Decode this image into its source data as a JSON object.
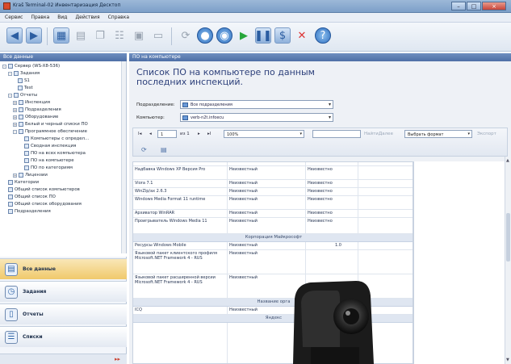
{
  "window": {
    "title": "Kraš Terminal-02 Инвентаризация Десктоп",
    "min": "–",
    "max": "□",
    "close": "×"
  },
  "menu": [
    "Сервис",
    "Правка",
    "Вид",
    "Действия",
    "Справка"
  ],
  "toolbar": {
    "icons": [
      "back-icon",
      "forward-icon",
      "grid-icon",
      "print-icon",
      "copy-icon",
      "tree-icon",
      "calendar-icon",
      "chat-icon",
      "refresh-icon",
      "stop-icon",
      "play-icon",
      "pause-icon",
      "link-icon",
      "delete-icon",
      "help-icon"
    ]
  },
  "left_panel": {
    "header": "Все данные",
    "tree": [
      {
        "label": "Сервер (WS-X8-536)",
        "level": 0,
        "toggle": "–"
      },
      {
        "label": "Задания",
        "level": 1,
        "toggle": "–"
      },
      {
        "label": "S1",
        "level": 2,
        "toggle": ""
      },
      {
        "label": "Test",
        "level": 2,
        "toggle": ""
      },
      {
        "label": "Отчеты",
        "level": 1,
        "toggle": "–"
      },
      {
        "label": "Инспекция",
        "level": 2,
        "toggle": "+"
      },
      {
        "label": "Подразделения",
        "level": 2,
        "toggle": "+"
      },
      {
        "label": "Оборудование",
        "level": 2,
        "toggle": "+"
      },
      {
        "label": "Белый и черный списки ПО",
        "level": 2,
        "toggle": "+"
      },
      {
        "label": "Программное обеспечение",
        "level": 2,
        "toggle": "–"
      },
      {
        "label": "Компьютеры с определ...",
        "level": 3,
        "toggle": ""
      },
      {
        "label": "Сводная инспекция",
        "level": 3,
        "toggle": ""
      },
      {
        "label": "ПО на всех компьютера",
        "level": 3,
        "toggle": ""
      },
      {
        "label": "ПО на компьютере",
        "level": 3,
        "toggle": ""
      },
      {
        "label": "ПО по категориям",
        "level": 3,
        "toggle": ""
      },
      {
        "label": "Лицензии",
        "level": 2,
        "toggle": "+"
      },
      {
        "label": "Категории",
        "level": 1,
        "toggle": ""
      },
      {
        "label": "Общий список компьютеров",
        "level": 1,
        "toggle": ""
      },
      {
        "label": "Общий список ПО",
        "level": 1,
        "toggle": ""
      },
      {
        "label": "Общий список оборудования",
        "level": 1,
        "toggle": ""
      },
      {
        "label": "Подразделения",
        "level": 1,
        "toggle": ""
      }
    ],
    "nav": [
      {
        "label": "Все данные",
        "icon": "database-icon",
        "active": true
      },
      {
        "label": "Задания",
        "icon": "clock-icon",
        "active": false
      },
      {
        "label": "Отчеты",
        "icon": "report-icon",
        "active": false
      },
      {
        "label": "Списки",
        "icon": "list-icon",
        "active": false
      }
    ],
    "footer_icon": "chevron-icon"
  },
  "right_panel": {
    "header": "ПО на компьютере",
    "title": "Список ПО на компьютере по данным последних инспекций.",
    "filters": {
      "dept_label": "Подразделение:",
      "dept_value": "Все подразделения",
      "comp_label": "Компьютер:",
      "comp_value": "verb-n2t.infoecu"
    },
    "report_toolbar": {
      "first": "I◂",
      "prev": "◂",
      "page": "1",
      "of": "из 1",
      "next": "▸",
      "last": "▸I",
      "zoom": "100%",
      "find_placeholder": "",
      "find": "Найти",
      "next_find": "Далее",
      "format": "Выбрать формат",
      "export": "Экспорт"
    },
    "rows": [
      {
        "type": "row",
        "name": "",
        "vendor": "",
        "status": ""
      },
      {
        "type": "row",
        "name": "Надбавка Windows XP Версия Pro",
        "vendor": "Неизвестный",
        "status": "Неизвестно"
      },
      {
        "type": "row",
        "name": "Viora 7.1",
        "vendor": "Неизвестный",
        "status": "Неизвестно"
      },
      {
        "type": "row",
        "name": "WinZip/ax 2.6.3",
        "vendor": "Неизвестный",
        "status": "Неизвестно"
      },
      {
        "type": "row",
        "name": "Windows Media Format 11 runtime",
        "vendor": "Неизвестный",
        "status": "Неизвестно"
      },
      {
        "type": "row",
        "name": "Архиватор WinRAR",
        "vendor": "Неизвестный",
        "status": "Неизвестно"
      },
      {
        "type": "row",
        "name": "Проигрыватель Windows Media 11",
        "vendor": "Неизвестный",
        "status": "Неизвестно"
      },
      {
        "type": "group",
        "label": "Корпорация Майкрософт"
      },
      {
        "type": "row",
        "name": "Ресурсы Windows Mobile",
        "vendor": "Неизвестный",
        "status": "1.0"
      },
      {
        "type": "row",
        "name": "Языковой пакет клиентского профиля Microsoft.NET Framework 4 - RUS",
        "vendor": "Неизвестный",
        "status": ""
      },
      {
        "type": "row",
        "name": "Языковой пакет расширенной версии Microsoft.NET Framework 4 - RUS",
        "vendor": "Неизвестный",
        "status": ""
      },
      {
        "type": "group",
        "label": "Название орга"
      },
      {
        "type": "row",
        "name": "ICQ",
        "vendor": "Неизвестный",
        "status": ""
      },
      {
        "type": "group",
        "label": "Яндекс"
      }
    ]
  }
}
